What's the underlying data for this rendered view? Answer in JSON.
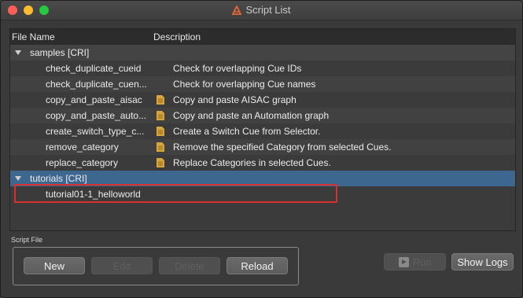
{
  "window": {
    "title": "Script List"
  },
  "tree": {
    "columns": {
      "name": "File Name",
      "description": "Description"
    },
    "groups": [
      {
        "label": "samples [CRI]",
        "items": [
          {
            "name": "check_duplicate_cueid",
            "description": "Check for overlapping Cue IDs",
            "doc_icon": false
          },
          {
            "name": "check_duplicate_cuen...",
            "description": "Check for overlapping Cue names",
            "doc_icon": false
          },
          {
            "name": "copy_and_paste_aisac",
            "description": "Copy and paste AISAC graph",
            "doc_icon": true
          },
          {
            "name": "copy_and_paste_auto...",
            "description": "Copy and paste an Automation graph",
            "doc_icon": true
          },
          {
            "name": "create_switch_type_c...",
            "description": "Create a Switch Cue from Selector.",
            "doc_icon": true
          },
          {
            "name": "remove_category",
            "description": "Remove the specified Category from selected Cues.",
            "doc_icon": true
          },
          {
            "name": "replace_category",
            "description": "Replace Categories in selected Cues.",
            "doc_icon": true
          }
        ]
      },
      {
        "label": "tutorials [CRI]",
        "items": [
          {
            "name": "tutorial01-1_helloworld",
            "description": "",
            "doc_icon": false
          }
        ]
      }
    ]
  },
  "script_file": {
    "label": "Script File",
    "buttons": {
      "new": "New",
      "edit": "Edit",
      "delete": "Delete",
      "reload": "Reload"
    }
  },
  "actions": {
    "run": "Run",
    "show_logs": "Show Logs"
  },
  "colors": {
    "selection": "#3e6790",
    "highlight_box": "#d9302e",
    "doc_icon": "#d9a43a",
    "logo": "#e8663a"
  }
}
